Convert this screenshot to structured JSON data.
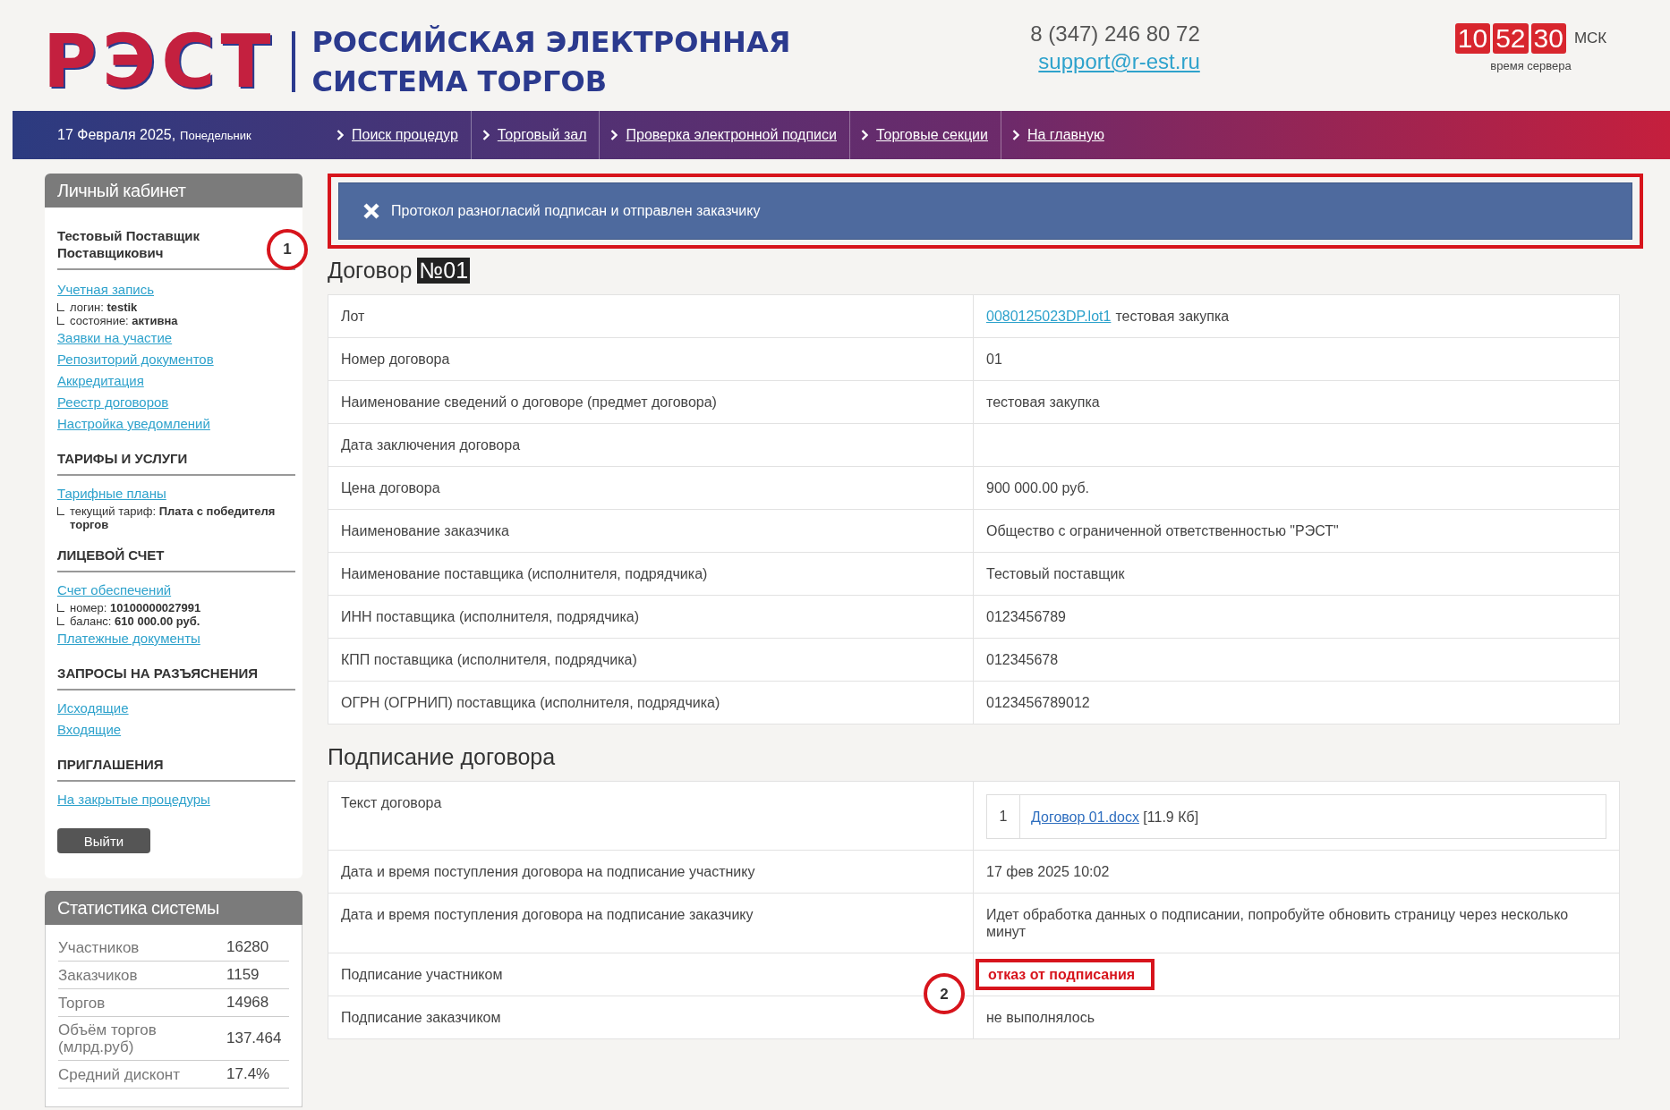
{
  "header": {
    "logo": "РЭСТ",
    "title_lines": [
      "РОССИЙСКАЯ ЭЛЕКТРОННАЯ",
      "СИСТЕМА ТОРГОВ"
    ],
    "phone": "8 (347) 246 80 72",
    "email": "support@r-est.ru",
    "clock": {
      "digits": [
        "10",
        "52",
        "30"
      ],
      "zone": "МСК",
      "caption": "время сервера"
    }
  },
  "nav": {
    "date": "17 Февраля 2025,",
    "weekday": "Понедельник",
    "links": [
      "Поиск процедур",
      "Торговый зал",
      "Проверка электронной подписи",
      "Торговые секции",
      "На главную"
    ]
  },
  "sidebar": {
    "title": "Личный кабинет",
    "user": "Тестовый Поставщик Поставщикович",
    "annotation": "1",
    "groups": [
      {
        "items": [
          {
            "kind": "link",
            "text": "Учетная запись"
          },
          {
            "kind": "detail",
            "label": "логин:",
            "value": "testik"
          },
          {
            "kind": "detail",
            "label": "состояние:",
            "value": "активна"
          },
          {
            "kind": "link",
            "text": "Заявки на участие"
          },
          {
            "kind": "link",
            "text": "Репозиторий документов"
          },
          {
            "kind": "link",
            "text": "Аккредитация"
          },
          {
            "kind": "link",
            "text": "Реестр договоров"
          },
          {
            "kind": "link",
            "text": "Настройка уведомлений"
          }
        ]
      },
      {
        "heading": "ТАРИФЫ И УСЛУГИ",
        "items": [
          {
            "kind": "link",
            "text": "Тарифные планы"
          },
          {
            "kind": "detail",
            "label": "текущий тариф:",
            "value": "Плата с победителя торгов"
          }
        ]
      },
      {
        "heading": "ЛИЦЕВОЙ СЧЕТ",
        "items": [
          {
            "kind": "link",
            "text": "Счет обеспечений"
          },
          {
            "kind": "detail",
            "label": "номер:",
            "value": "10100000027991"
          },
          {
            "kind": "detail",
            "label": "баланс:",
            "value": "610 000.00 руб."
          },
          {
            "kind": "link",
            "text": "Платежные документы"
          }
        ]
      },
      {
        "heading": "ЗАПРОСЫ НА РАЗЪЯСНЕНИЯ",
        "items": [
          {
            "kind": "link",
            "text": "Исходящие"
          },
          {
            "kind": "link",
            "text": "Входящие"
          }
        ]
      },
      {
        "heading": "ПРИГЛАШЕНИЯ",
        "items": [
          {
            "kind": "link",
            "text": "На закрытые процедуры"
          }
        ]
      }
    ],
    "logout": "Выйти"
  },
  "stats": {
    "title": "Статистика системы",
    "rows": [
      {
        "label": "Участников",
        "value": "16280"
      },
      {
        "label": "Заказчиков",
        "value": "1159"
      },
      {
        "label": "Торгов",
        "value": "14968"
      },
      {
        "label": "Объём торгов (млрд.руб)",
        "value": "137.464"
      },
      {
        "label": "Средний дисконт",
        "value": "17.4%"
      }
    ]
  },
  "alert": {
    "text": "Протокол разногласий подписан и отправлен заказчику"
  },
  "contract": {
    "title": "Договор",
    "number": "№01",
    "rows": [
      {
        "label": "Лот",
        "link": "0080125023DP.lot1",
        "value": "тестовая закупка"
      },
      {
        "label": "Номер договора",
        "value": "01"
      },
      {
        "label": "Наименование сведений о договоре (предмет договора)",
        "value": "тестовая закупка"
      },
      {
        "label": "Дата заключения договора"
      },
      {
        "label": "Цена договора",
        "value": "900 000.00 руб."
      },
      {
        "label": "Наименование заказчика",
        "value": "Общество с ограниченной ответственностью \"РЭСТ\""
      },
      {
        "label": "Наименование поставщика (исполнителя, подрядчика)",
        "value": "Тестовый поставщик"
      },
      {
        "label": "ИНН поставщика (исполнителя, подрядчика)",
        "value": "0123456789"
      },
      {
        "label": "КПП поставщика (исполнителя, подрядчика)",
        "value": "012345678"
      },
      {
        "label": "ОГРН (ОГРНИП) поставщика (исполнителя, подрядчика)",
        "value": "0123456789012"
      }
    ]
  },
  "signing": {
    "title": "Подписание договора",
    "rows": [
      {
        "kind": "file",
        "label": "Текст договора",
        "index": "1",
        "link": "Договор 01.docx",
        "size": "[11.9 Кб]"
      },
      {
        "kind": "text",
        "label": "Дата и время поступления договора на подписание участнику",
        "value": "17 фев 2025 10:02"
      },
      {
        "kind": "text",
        "label": "Дата и время поступления договора на подписание заказчику",
        "value": "Идет обработка данных о подписании, попробуйте обновить страницу через несколько минут"
      },
      {
        "kind": "status",
        "label": "Подписание участником",
        "value": "отказ от подписания",
        "annotation": "2"
      },
      {
        "kind": "text",
        "label": "Подписание заказчиком",
        "value": "не выполнялось"
      }
    ]
  }
}
